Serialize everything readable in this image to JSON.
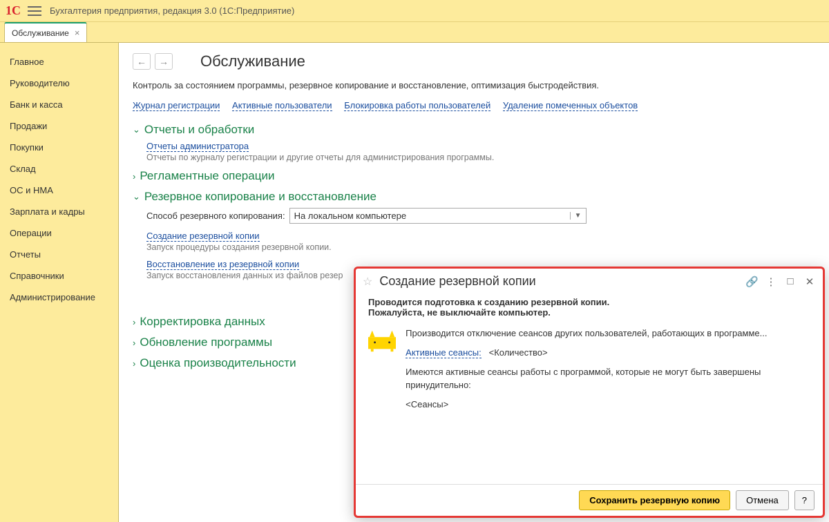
{
  "app": {
    "title": "Бухгалтерия предприятия, редакция 3.0  (1С:Предприятие)"
  },
  "tab": {
    "label": "Обслуживание"
  },
  "sidebar": {
    "items": [
      {
        "label": "Главное"
      },
      {
        "label": "Руководителю"
      },
      {
        "label": "Банк и касса"
      },
      {
        "label": "Продажи"
      },
      {
        "label": "Покупки"
      },
      {
        "label": "Склад"
      },
      {
        "label": "ОС и НМА"
      },
      {
        "label": "Зарплата и кадры"
      },
      {
        "label": "Операции"
      },
      {
        "label": "Отчеты"
      },
      {
        "label": "Справочники"
      },
      {
        "label": "Администрирование"
      }
    ]
  },
  "page": {
    "title": "Обслуживание",
    "desc": "Контроль за состоянием программы, резервное копирование и восстановление, оптимизация быстродействия.",
    "links": [
      "Журнал регистрации",
      "Активные пользователи",
      "Блокировка работы пользователей",
      "Удаление помеченных объектов"
    ]
  },
  "sections": {
    "reports": {
      "title": "Отчеты и обработки",
      "link": "Отчеты администратора",
      "desc": "Отчеты по журналу регистрации и другие отчеты для администрирования программы."
    },
    "routine": {
      "title": "Регламентные операции"
    },
    "backup": {
      "title": "Резервное копирование и восстановление",
      "method_label": "Способ резервного копирования:",
      "method_value": "На локальном компьютере",
      "create_link": "Создание резервной копии",
      "create_desc": "Запуск процедуры создания резервной копии.",
      "restore_link": "Восстановление из резервной копии",
      "restore_desc": "Запуск восстановления данных из файлов резер"
    },
    "correct": {
      "title": "Корректировка данных"
    },
    "update": {
      "title": "Обновление программы"
    },
    "perf": {
      "title": "Оценка производительности"
    }
  },
  "dialog": {
    "title": "Создание резервной копии",
    "line1": "Проводится подготовка к созданию резервной копии.",
    "line2": "Пожалуйста, не выключайте компьютер.",
    "text1": "Производится отключение сеансов других пользователей, работающих в программе...",
    "sessions_link": "Активные сеансы:",
    "sessions_value": "<Количество>",
    "text2": "Имеются активные сеансы работы с программой, которые не могут быть завершены принудительно:",
    "text3": "<Сеансы>",
    "save_btn": "Сохранить резервную копию",
    "cancel_btn": "Отмена",
    "help_btn": "?"
  }
}
